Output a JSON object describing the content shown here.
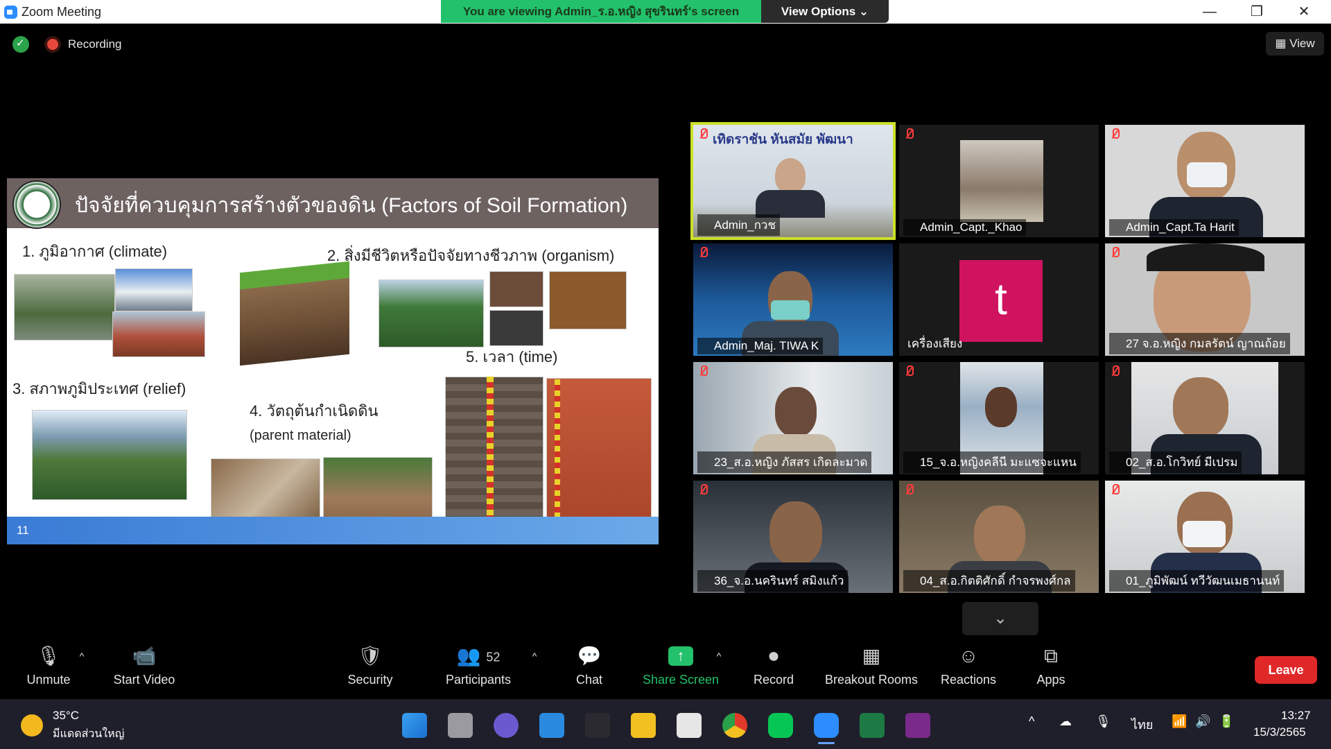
{
  "titlebar": {
    "app_title": "Zoom Meeting",
    "banner": "You are viewing Admin_ร.อ.หญิง สุขรินทร์'s screen",
    "view_options": "View Options ⌄",
    "minimize": "—",
    "maximize": "❐",
    "close": "✕"
  },
  "status": {
    "recording": "Recording",
    "view": "View"
  },
  "slide": {
    "title": "ปัจจัยที่ควบคุมการสร้างตัวของดิน (Factors of Soil Formation)",
    "item1": "1. ภูมิอากาศ (climate)",
    "item2": "2. สิ่งมีชีวิตหรือปัจจัยทางชีวภาพ (organism)",
    "item3": "3. สภาพภูมิประเทศ (relief)",
    "item4a": "4. วัตถุต้นกำเนิดดิน",
    "item4b": "(parent material)",
    "item5": "5. เวลา (time)",
    "page_number": "11"
  },
  "participants": [
    {
      "name": "Admin_กวช",
      "banner_text": "เทิดราชัน   หันสมัย   พัฒนา"
    },
    {
      "name": "Admin_Capt._Khao"
    },
    {
      "name": "Admin_Capt.Ta Harit"
    },
    {
      "name": "Admin_Maj. TIWA K"
    },
    {
      "name": "เครื่องเสียง",
      "avatar_letter": "t"
    },
    {
      "name": "27 จ.อ.หญิง กมลรัตน์ ญาณถ้อย"
    },
    {
      "name": "23_ส.อ.หญิง ภัสสร เกิดละมาด"
    },
    {
      "name": "15_จ.อ.หญิงคลีนี มะแซจะแหน"
    },
    {
      "name": "02_ส.อ.โกวิทย์ มีเปรม"
    },
    {
      "name": "36_จ.อ.นครินทร์ สมิงแก้ว"
    },
    {
      "name": "04_ส.อ.กิตติศักดิ์ กำจรพงศ์กล"
    },
    {
      "name": "01_ภูมิพัฒน์ ทวีวัฒนเมธานนท์"
    }
  ],
  "toolbar": {
    "unmute": "Unmute",
    "start_video": "Start Video",
    "security": "Security",
    "participants": "Participants",
    "participants_count": "52",
    "chat": "Chat",
    "share_screen": "Share Screen",
    "record": "Record",
    "breakout_rooms": "Breakout Rooms",
    "reactions": "Reactions",
    "apps": "Apps",
    "leave": "Leave",
    "more_arrow": "⌄"
  },
  "taskbar": {
    "temperature": "35°C",
    "weather": "มีแดดส่วนใหญ่",
    "language": "ไทย",
    "time": "13:27",
    "date": "15/3/2565"
  },
  "colors": {
    "share_green": "#23c16b",
    "active_border": "#cce02a",
    "leave_red": "#e02828",
    "brand_blue": "#2d8cff"
  }
}
